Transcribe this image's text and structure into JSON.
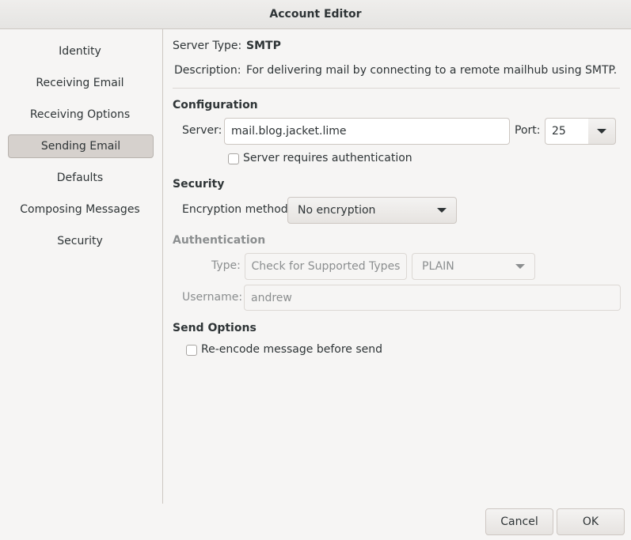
{
  "window": {
    "title": "Account Editor"
  },
  "sidebar": {
    "items": [
      {
        "label": "Identity"
      },
      {
        "label": "Receiving Email"
      },
      {
        "label": "Receiving Options"
      },
      {
        "label": "Sending Email",
        "active": true
      },
      {
        "label": "Defaults"
      },
      {
        "label": "Composing Messages"
      },
      {
        "label": "Security"
      }
    ]
  },
  "server_type": {
    "label": "Server Type:",
    "value": "SMTP"
  },
  "description": {
    "label": "Description:",
    "value": "For delivering mail by connecting to a remote mailhub using SMTP."
  },
  "configuration": {
    "heading": "Configuration",
    "server_label": "Server:",
    "server_value": "mail.blog.jacket.lime",
    "port_label": "Port:",
    "port_value": "25",
    "requires_auth_label": "Server requires authentication",
    "requires_auth_checked": false
  },
  "security": {
    "heading": "Security",
    "encryption_label": "Encryption method:",
    "encryption_value": "No encryption"
  },
  "authentication": {
    "heading": "Authentication",
    "type_label": "Type:",
    "check_types_button": "Check for Supported Types",
    "type_value": "PLAIN",
    "username_label": "Username:",
    "username_value": "andrew"
  },
  "send_options": {
    "heading": "Send Options",
    "reencode_label": "Re-encode message before send",
    "reencode_checked": false
  },
  "footer": {
    "cancel_label": "Cancel",
    "ok_label": "OK"
  },
  "icons": {
    "dropdown": "chevron-down-icon"
  },
  "colors": {
    "background": "#f6f5f4",
    "selected_nav": "#d6d1cd",
    "text": "#2e3436",
    "disabled_text": "#8b8e8f"
  }
}
